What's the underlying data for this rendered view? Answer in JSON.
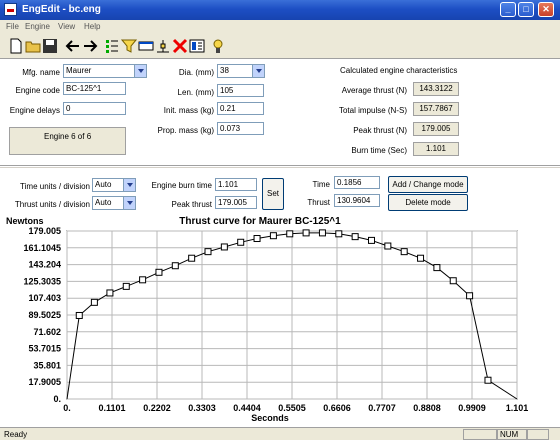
{
  "window": {
    "title": "EngEdit - bc.eng"
  },
  "menu": [
    "File",
    "Engine",
    "View",
    "Help"
  ],
  "form": {
    "mfg_label": "Mfg. name",
    "mfg_value": "Maurer",
    "code_label": "Engine code",
    "code_value": "BC-125^1",
    "delays_label": "Engine delays",
    "delays_value": "0",
    "engine_count": "Engine 6 of 6",
    "dia_label": "Dia. (mm)",
    "dia_value": "38",
    "len_label": "Len. (mm)",
    "len_value": "105",
    "init_mass_label": "Init. mass (kg)",
    "init_mass_value": "0.21",
    "prop_mass_label": "Prop. mass (kg)",
    "prop_mass_value": "0.073"
  },
  "characteristics": {
    "heading": "Calculated engine characteristics",
    "avg_thrust_label": "Average thrust (N)",
    "avg_thrust_value": "143.3122",
    "total_impulse_label": "Total impulse (N-S)",
    "total_impulse_value": "157.7867",
    "peak_thrust_label": "Peak thrust (N)",
    "peak_thrust_value": "179.005",
    "burn_time_label": "Burn time (Sec)",
    "burn_time_value": "1.101"
  },
  "controls": {
    "time_units_label": "Time units / division",
    "time_units_value": "Auto",
    "thrust_units_label": "Thrust units / division",
    "thrust_units_value": "Auto",
    "burn_time_label": "Engine burn time",
    "burn_time_value": "1.101",
    "peak_thrust_label": "Peak thrust",
    "peak_thrust_value": "179.005",
    "set_label": "Set",
    "time_label": "Time",
    "time_value": "0.1856",
    "thrust_label": "Thrust",
    "thrust_value": "130.9604",
    "add_label": "Add / Change mode",
    "delete_label": "Delete mode"
  },
  "chart_data": {
    "type": "line",
    "title": "Thrust curve for Maurer BC-125^1",
    "xlabel": "Seconds",
    "ylabel": "Newtons",
    "xlim": [
      0,
      1.101
    ],
    "ylim": [
      0,
      179.005
    ],
    "x_ticks": [
      "0.",
      "0.1101",
      "0.2202",
      "0.3303",
      "0.4404",
      "0.5505",
      "0.6606",
      "0.7707",
      "0.8808",
      "0.9909",
      "1.101"
    ],
    "y_ticks": [
      "0.",
      "17.9005",
      "35.801",
      "53.7015",
      "71.602",
      "89.5025",
      "107.403",
      "125.3035",
      "143.204",
      "161.1045",
      "179.005"
    ],
    "grid": true,
    "line_color": "#000000",
    "x": [
      0,
      0.03,
      0.067,
      0.105,
      0.145,
      0.185,
      0.225,
      0.265,
      0.305,
      0.345,
      0.385,
      0.425,
      0.465,
      0.505,
      0.545,
      0.585,
      0.625,
      0.665,
      0.705,
      0.745,
      0.785,
      0.825,
      0.865,
      0.905,
      0.945,
      0.985,
      1.03,
      1.101
    ],
    "y": [
      0,
      89,
      103,
      113,
      120,
      127,
      135,
      142,
      150,
      157,
      162,
      167,
      171,
      174,
      176,
      177,
      177,
      176,
      173,
      169,
      163,
      157,
      150,
      140,
      126,
      110,
      20,
      0
    ]
  },
  "status": {
    "text": "Ready",
    "num": "NUM"
  }
}
